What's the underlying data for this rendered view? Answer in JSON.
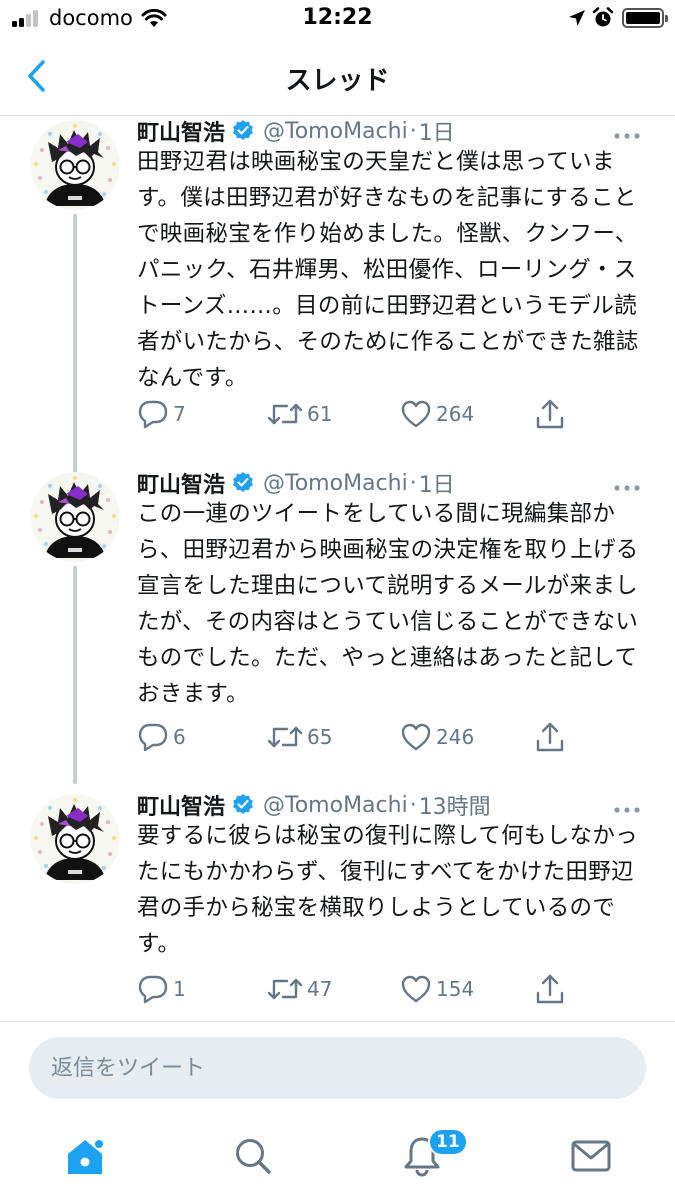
{
  "status_bar": {
    "carrier": "docomo",
    "time": "12:22",
    "battery_level": 0.95
  },
  "header": {
    "title": "スレッド"
  },
  "colors": {
    "accent": "#1da1f2",
    "secondary_text": "#657786",
    "thread_line": "#c5ccd3"
  },
  "tweets": [
    {
      "name": "町山智浩",
      "handle": "@TomoMachi",
      "separator": "·",
      "time": "1日",
      "text": "田野辺君は映画秘宝の天皇だと僕は思っています。僕は田野辺君が好きなものを記事にすることで映画秘宝を作り始めました。怪獣、クンフー、パニック、石井輝男、松田優作、ローリング・ストーンズ……。目の前に田野辺君というモデル読者がいたから、そのために作ることができた雑誌なんです。",
      "replies": "7",
      "retweets": "61",
      "likes": "264"
    },
    {
      "name": "町山智浩",
      "handle": "@TomoMachi",
      "separator": "·",
      "time": "1日",
      "text": "この一連のツイートをしている間に現編集部から、田野辺君から映画秘宝の決定権を取り上げる宣言をした理由について説明するメールが来ましたが、その内容はとうてい信じることができないものでした。ただ、やっと連絡はあったと記しておきます。",
      "replies": "6",
      "retweets": "65",
      "likes": "246"
    },
    {
      "name": "町山智浩",
      "handle": "@TomoMachi",
      "separator": "·",
      "time": "13時間",
      "text": "要するに彼らは秘宝の復刊に際して何もしなかったにもかかわらず、復刊にすべてをかけた田野辺君の手から秘宝を横取りしようとしているのです。",
      "replies": "1",
      "retweets": "47",
      "likes": "154"
    }
  ],
  "reply_box": {
    "placeholder": "返信をツイート"
  },
  "tab_bar": {
    "notifications_badge": "11"
  }
}
